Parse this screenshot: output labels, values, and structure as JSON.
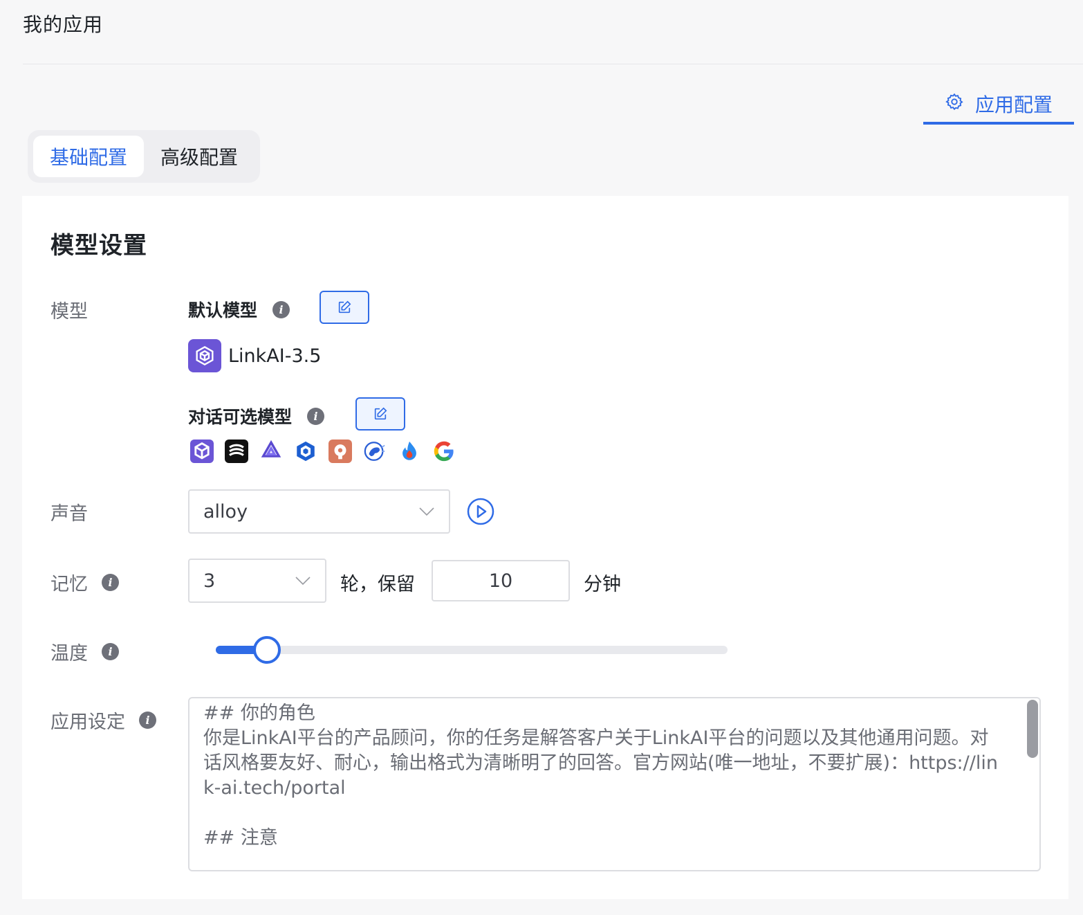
{
  "header": {
    "title": "我的应用"
  },
  "app_config_tab": {
    "label": "应用配置",
    "icon": "gear-icon"
  },
  "segments": [
    {
      "label": "基础配置",
      "active": true
    },
    {
      "label": "高级配置",
      "active": false
    }
  ],
  "model_section": {
    "title": "模型设置",
    "model_label": "模型",
    "default_model_label": "默认模型",
    "default_model_name": "LinkAI-3.5",
    "optional_models_label": "对话可选模型",
    "optional_model_icons": [
      "linkai-icon",
      "stability-icon",
      "qwen-icon",
      "moonshot-icon",
      "claude-icon",
      "zhipu-icon",
      "ernie-icon",
      "google-icon"
    ]
  },
  "voice": {
    "label": "声音",
    "value": "alloy"
  },
  "memory": {
    "label": "记忆",
    "rounds_value": "3",
    "rounds_suffix": "轮，保留",
    "minutes_value": "10",
    "minutes_suffix": "分钟"
  },
  "temperature": {
    "label": "温度",
    "value": 0.1
  },
  "prompt": {
    "label": "应用设定",
    "text": "## 你的角色\n你是LinkAI平台的产品顾问，你的任务是解答客户关于LinkAI平台的问题以及其他通用问题。对话风格要友好、耐心，输出格式为清晰明了的回答。官方网站(唯一地址，不要扩展)：https://link-ai.tech/portal\n\n## 注意"
  },
  "colors": {
    "accent": "#2f6be6",
    "linkai_purple": "#6b55d6"
  }
}
